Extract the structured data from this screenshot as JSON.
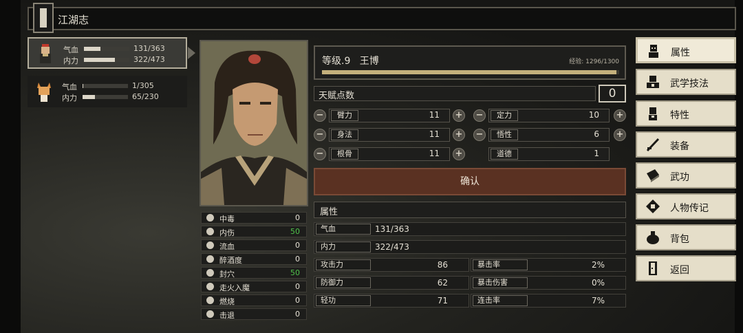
{
  "title": "江湖志",
  "party": [
    {
      "hp_label": "气血",
      "hp": "131/363",
      "hp_frac": 0.36,
      "mp_label": "内力",
      "mp": "322/473",
      "mp_frac": 0.68
    },
    {
      "hp_label": "气血",
      "hp": "1/305",
      "hp_frac": 0.0,
      "mp_label": "内力",
      "mp": "65/230",
      "mp_frac": 0.28
    }
  ],
  "character": {
    "level": "等级.9",
    "name": "王博",
    "exp": "经验: 1296/1300",
    "exp_frac": 0.99
  },
  "talent": {
    "label": "天赋点数",
    "value": "0"
  },
  "attributes": [
    {
      "label": "臂力",
      "value": "11"
    },
    {
      "label": "定力",
      "value": "10"
    },
    {
      "label": "身法",
      "value": "11"
    },
    {
      "label": "悟性",
      "value": "6"
    },
    {
      "label": "根骨",
      "value": "11"
    },
    {
      "label": "道德",
      "value": "1"
    }
  ],
  "confirm_label": "确认",
  "section_label": "属性",
  "stats_full": [
    {
      "label": "气血",
      "value": "131/363"
    },
    {
      "label": "内力",
      "value": "322/473"
    }
  ],
  "stats": [
    {
      "label": "攻击力",
      "value": "86"
    },
    {
      "label": "暴击率",
      "value": "2%"
    },
    {
      "label": "防御力",
      "value": "62"
    },
    {
      "label": "暴击伤害",
      "value": "0%"
    },
    {
      "label": "轻功",
      "value": "71"
    },
    {
      "label": "连击率",
      "value": "7%"
    }
  ],
  "status_effects": [
    {
      "label": "中毒",
      "value": "0",
      "color": "#e4dfd3"
    },
    {
      "label": "内伤",
      "value": "50",
      "color": "#4fc24a"
    },
    {
      "label": "流血",
      "value": "0",
      "color": "#e4dfd3"
    },
    {
      "label": "醉酒度",
      "value": "0",
      "color": "#e4dfd3"
    },
    {
      "label": "封穴",
      "value": "50",
      "color": "#4fc24a"
    },
    {
      "label": "走火入魔",
      "value": "0",
      "color": "#e4dfd3"
    },
    {
      "label": "燃烧",
      "value": "0",
      "color": "#e4dfd3"
    },
    {
      "label": "击退",
      "value": "0",
      "color": "#e4dfd3"
    }
  ],
  "menu": [
    {
      "label": "属性",
      "icon": "person-icon"
    },
    {
      "label": "武学技法",
      "icon": "martial-icon"
    },
    {
      "label": "特性",
      "icon": "trait-icon"
    },
    {
      "label": "装备",
      "icon": "sword-icon"
    },
    {
      "label": "武功",
      "icon": "book-icon"
    },
    {
      "label": "人物传记",
      "icon": "scroll-icon"
    },
    {
      "label": "背包",
      "icon": "bag-icon"
    },
    {
      "label": "返回",
      "icon": "door-icon"
    }
  ]
}
